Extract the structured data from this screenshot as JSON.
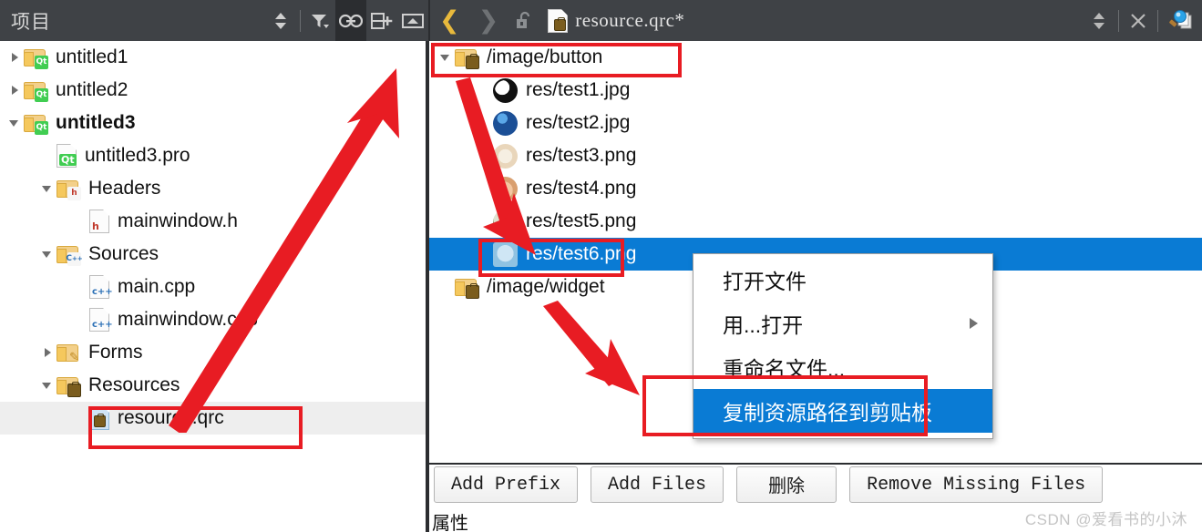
{
  "window": {
    "toolbar_left_title": "项目",
    "document_title": "resource.qrc*"
  },
  "toolbar": {
    "left_icons": [
      {
        "name": "sort-updown-icon",
        "glyph": "⬍"
      },
      {
        "name": "filter-icon",
        "glyph": "▼"
      },
      {
        "name": "link-sync-icon",
        "glyph": "⚭",
        "active": true
      },
      {
        "name": "split-add-icon",
        "glyph": "＋"
      },
      {
        "name": "collapse-panel-icon",
        "glyph": "▲"
      }
    ],
    "right_icons": [
      {
        "name": "back-arrow-icon",
        "glyph": "❬",
        "state": "enabled"
      },
      {
        "name": "forward-arrow-icon",
        "glyph": "❭",
        "state": "disabled"
      },
      {
        "name": "unlock-icon",
        "glyph": "🔓"
      },
      {
        "name": "qrc-file-icon",
        "glyph": "doc"
      },
      {
        "name": "split-updown-icon",
        "glyph": "⬍"
      },
      {
        "name": "close-icon",
        "glyph": "✕"
      },
      {
        "name": "search-documents-icon",
        "glyph": "🔍"
      }
    ]
  },
  "project_tree": {
    "items": [
      {
        "label": "untitled1",
        "indent": 0,
        "twisty": "collapsed",
        "icon": "folder-qt-icon",
        "bold": false,
        "selected": false
      },
      {
        "label": "untitled2",
        "indent": 0,
        "twisty": "collapsed",
        "icon": "folder-qt-icon",
        "bold": false,
        "selected": false
      },
      {
        "label": "untitled3",
        "indent": 0,
        "twisty": "expanded",
        "icon": "folder-qt-icon",
        "bold": true,
        "selected": false
      },
      {
        "label": "untitled3.pro",
        "indent": 1,
        "twisty": "none",
        "icon": "file-pro-icon",
        "bold": false,
        "selected": false
      },
      {
        "label": "Headers",
        "indent": 1,
        "twisty": "expanded",
        "icon": "folder-h-icon",
        "bold": false,
        "selected": false
      },
      {
        "label": "mainwindow.h",
        "indent": 2,
        "twisty": "none",
        "icon": "file-h-icon",
        "bold": false,
        "selected": false
      },
      {
        "label": "Sources",
        "indent": 1,
        "twisty": "expanded",
        "icon": "folder-cpp-icon",
        "bold": false,
        "selected": false
      },
      {
        "label": "main.cpp",
        "indent": 2,
        "twisty": "none",
        "icon": "file-cpp-icon",
        "bold": false,
        "selected": false
      },
      {
        "label": "mainwindow.cpp",
        "indent": 2,
        "twisty": "none",
        "icon": "file-cpp-icon",
        "bold": false,
        "selected": false
      },
      {
        "label": "Forms",
        "indent": 1,
        "twisty": "collapsed",
        "icon": "folder-ui-icon",
        "bold": false,
        "selected": false
      },
      {
        "label": "Resources",
        "indent": 1,
        "twisty": "expanded",
        "icon": "folder-qrc-icon",
        "bold": false,
        "selected": false
      },
      {
        "label": "resource.qrc",
        "indent": 2,
        "twisty": "none",
        "icon": "file-qrc-icon",
        "bold": false,
        "selected": true
      }
    ]
  },
  "resource_tree": {
    "items": [
      {
        "label": "/image/button",
        "indent": 0,
        "twisty": "expanded",
        "icon": "folder-prefix-icon",
        "thumb": null,
        "selected": false
      },
      {
        "label": "res/test1.jpg",
        "indent": 1,
        "twisty": "none",
        "icon": "image-thumb",
        "thumb": "t1",
        "selected": false
      },
      {
        "label": "res/test2.jpg",
        "indent": 1,
        "twisty": "none",
        "icon": "image-thumb",
        "thumb": "t2",
        "selected": false
      },
      {
        "label": "res/test3.png",
        "indent": 1,
        "twisty": "none",
        "icon": "image-thumb",
        "thumb": "t3",
        "selected": false
      },
      {
        "label": "res/test4.png",
        "indent": 1,
        "twisty": "none",
        "icon": "image-thumb",
        "thumb": "t4",
        "selected": false
      },
      {
        "label": "res/test5.png",
        "indent": 1,
        "twisty": "none",
        "icon": "image-thumb",
        "thumb": "t5",
        "selected": false
      },
      {
        "label": "res/test6.png",
        "indent": 1,
        "twisty": "none",
        "icon": "image-thumb",
        "thumb": "t6",
        "selected": true
      },
      {
        "label": "/image/widget",
        "indent": 0,
        "twisty": "none",
        "icon": "folder-prefix-icon",
        "thumb": null,
        "selected": false
      }
    ]
  },
  "context_menu": {
    "items": [
      {
        "label": "打开文件",
        "highlighted": false,
        "submenu": false
      },
      {
        "label": "用...打开",
        "highlighted": false,
        "submenu": true
      },
      {
        "label": "重命名文件...",
        "highlighted": false,
        "submenu": false
      },
      {
        "label": "复制资源路径到剪贴板",
        "highlighted": true,
        "submenu": false
      }
    ]
  },
  "button_bar": {
    "buttons": [
      {
        "label": "Add Prefix"
      },
      {
        "label": "Add Files"
      },
      {
        "label": "删除"
      },
      {
        "label": "Remove Missing Files"
      }
    ]
  },
  "status": {
    "properties_label": "属性",
    "watermark": "CSDN @爱看书的小沐"
  },
  "annotations": {
    "highlight_color": "#e81c23",
    "boxes": [
      {
        "name": "resource-qrc-highlight-box"
      },
      {
        "name": "image-button-prefix-highlight-box"
      },
      {
        "name": "test6-png-highlight-box"
      },
      {
        "name": "copy-resource-path-highlight-box"
      }
    ],
    "arrows": [
      {
        "name": "arrow-qrc-to-prefix"
      },
      {
        "name": "arrow-prefix-to-test6"
      },
      {
        "name": "arrow-widget-to-copy-path"
      }
    ]
  },
  "colors": {
    "toolbar_bg": "#3f4246",
    "selection_blue": "#0a7bd4",
    "selection_gray": "#eeeeee",
    "annotation_red": "#e81c23"
  }
}
